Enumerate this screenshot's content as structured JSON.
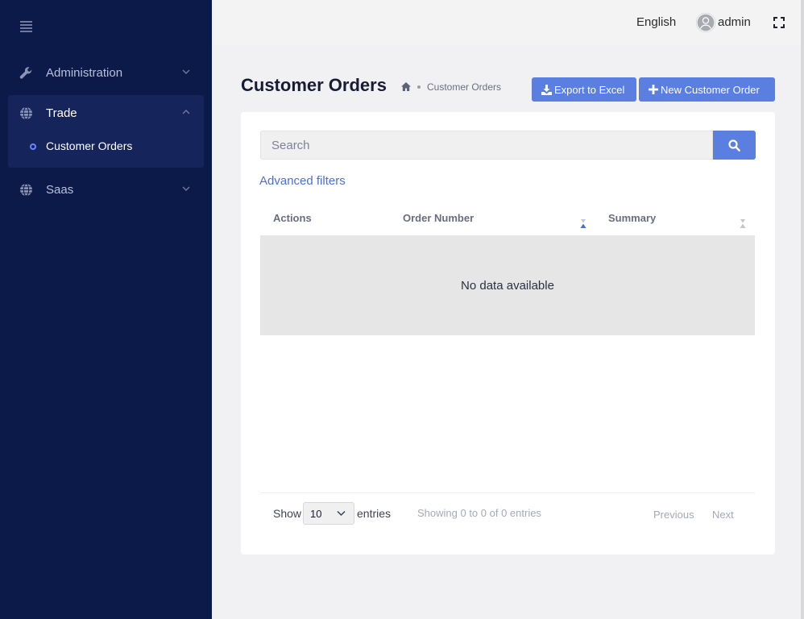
{
  "sidebar": {
    "items": [
      {
        "label": "Administration",
        "icon": "wrench-icon"
      },
      {
        "label": "Trade",
        "icon": "globe-icon",
        "expanded": true,
        "children": [
          {
            "label": "Customer Orders",
            "active": true
          }
        ]
      },
      {
        "label": "Saas",
        "icon": "globe-icon"
      }
    ]
  },
  "header": {
    "language": "English",
    "username": "admin"
  },
  "page": {
    "title": "Customer Orders",
    "breadcrumb": "Customer Orders"
  },
  "toolbar": {
    "export_label": "Export to Excel",
    "new_label": "New Customer Order"
  },
  "search": {
    "placeholder": "Search",
    "value": ""
  },
  "filters": {
    "advanced_label": "Advanced filters"
  },
  "table": {
    "columns": [
      "Actions",
      "Order Number",
      "Summary"
    ],
    "empty_message": "No data available"
  },
  "footer": {
    "show_label": "Show",
    "page_size": "10",
    "entries_label": "entries",
    "info": "Showing 0 to 0 of 0 entries",
    "previous_label": "Previous",
    "next_label": "Next"
  },
  "colors": {
    "sidebar_bg": "#0c1a4a",
    "accent": "#5b7fe0",
    "link": "#4a6fdb"
  }
}
